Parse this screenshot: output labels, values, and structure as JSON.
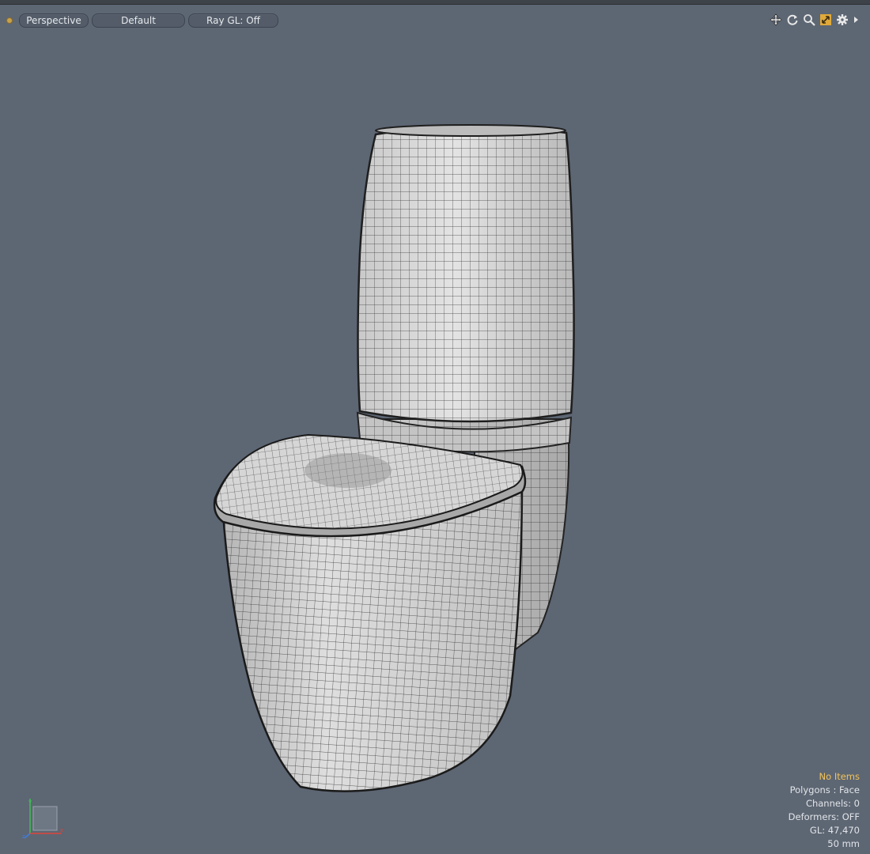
{
  "toolbar": {
    "view_mode": "Perspective",
    "shading": "Default",
    "raygl": "Ray GL: Off"
  },
  "nav_icons": [
    "move-view-icon",
    "rotate-view-icon",
    "zoom-view-icon",
    "fit-view-icon",
    "settings-gear-icon",
    "expand-arrow-icon"
  ],
  "hud": {
    "selection": "No Items",
    "polygons": "Polygons : Face",
    "channels": "Channels: 0",
    "deformers": "Deformers: OFF",
    "gl": "GL: 47,470",
    "lens": "50 mm"
  },
  "axis": {
    "x": "x",
    "y": "y",
    "z": "z"
  },
  "colors": {
    "viewport_bg": "#5d6673",
    "mesh_fill": "#d8d8d8",
    "wire": "#2a2a2a",
    "accent": "#f2c35a"
  }
}
